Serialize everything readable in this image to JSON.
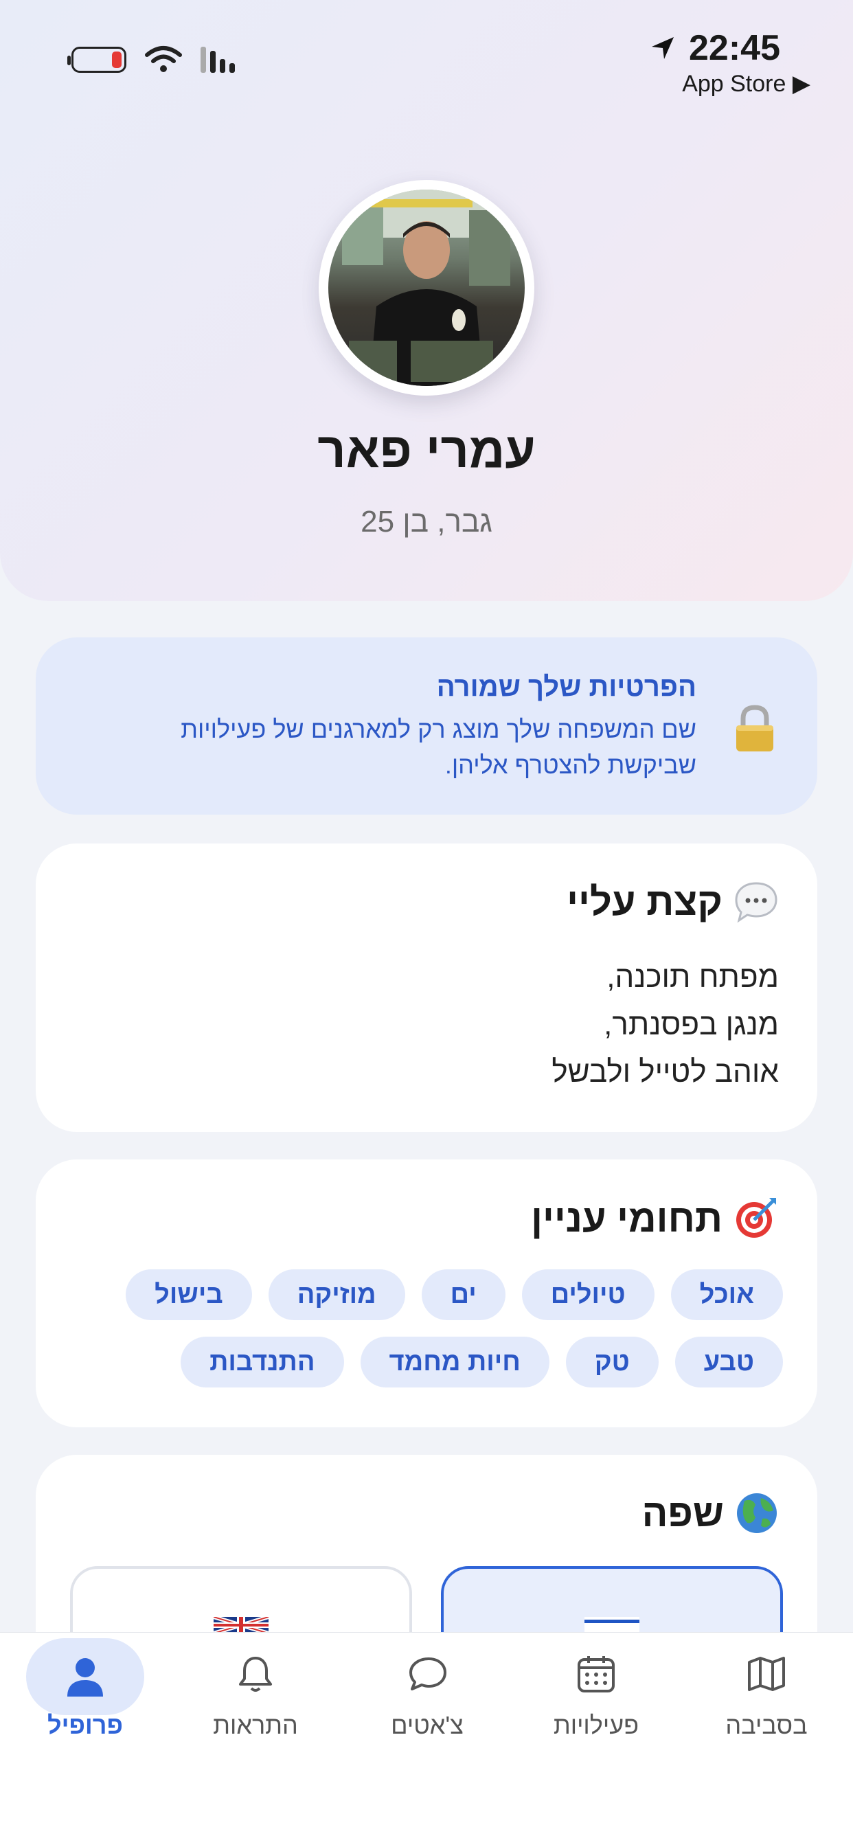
{
  "status_bar": {
    "time": "22:45",
    "back_app": "App Store ▶",
    "icons": [
      "battery-low-icon",
      "wifi-icon",
      "cellular-signal-icon",
      "location-arrow-icon"
    ]
  },
  "profile": {
    "name": "עמרי פאר",
    "subtitle": "גבר, בן 25"
  },
  "privacy": {
    "title": "הפרטיות שלך שמורה",
    "body": "שם המשפחה שלך מוצג רק למארגנים של פעילויות שביקשת להצטרף אליהן.",
    "icon": "lock-icon"
  },
  "about": {
    "title": "קצת עליי",
    "icon": "speech-bubble-icon",
    "lines": [
      "מפתח תוכנה,",
      "מנגן בפסנתר,",
      "אוהב לטייל ולבשל"
    ]
  },
  "interests": {
    "title": "תחומי עניין",
    "icon": "target-dart-icon",
    "chips": [
      "אוכל",
      "טיולים",
      "ים",
      "מוזיקה",
      "בישול",
      "טבע",
      "טק",
      "חיות מחמד",
      "התנדבות"
    ]
  },
  "language": {
    "title": "שפה",
    "icon": "globe-icon",
    "options": [
      {
        "flag": "israel-flag-icon",
        "selected": true
      },
      {
        "flag": "uk-flag-icon",
        "selected": false
      }
    ]
  },
  "nav": {
    "items": [
      {
        "label": "בסביבה",
        "icon": "map-icon",
        "active": false
      },
      {
        "label": "פעילויות",
        "icon": "calendar-icon",
        "active": false
      },
      {
        "label": "צ'אטים",
        "icon": "chat-icon",
        "active": false
      },
      {
        "label": "התראות",
        "icon": "bell-icon",
        "active": false
      },
      {
        "label": "פרופיל",
        "icon": "person-icon",
        "active": true
      }
    ]
  },
  "colors": {
    "accent": "#2f64d8",
    "accent_text": "#2b57c5",
    "chip_bg": "#e3eafb",
    "page_bg": "#f1f3f8"
  }
}
